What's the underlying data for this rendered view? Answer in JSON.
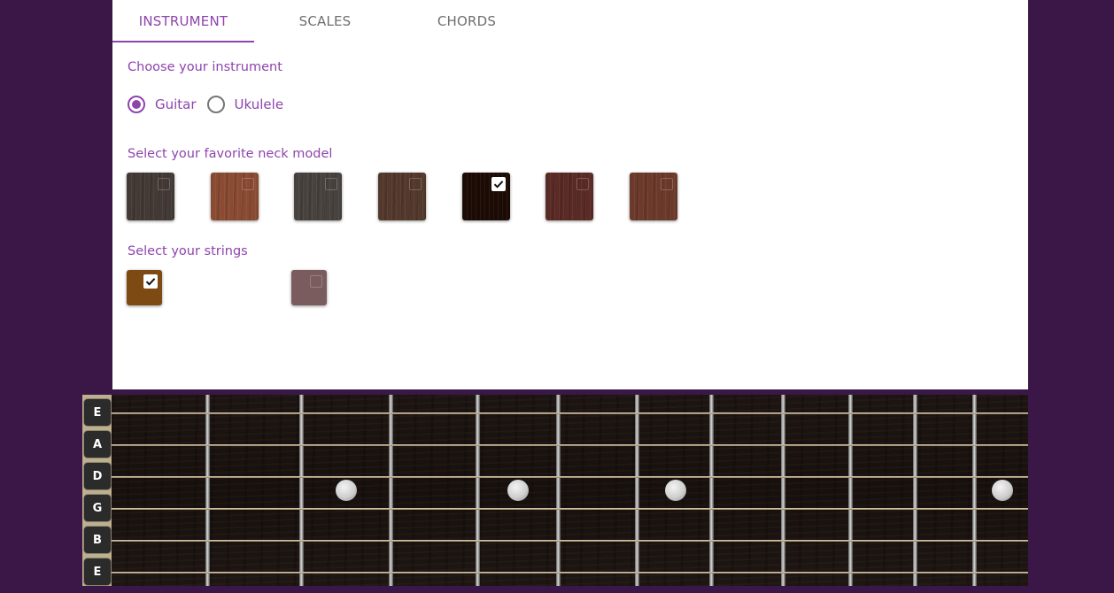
{
  "tabs": [
    {
      "label": "INSTRUMENT",
      "active": true
    },
    {
      "label": "SCALES",
      "active": false
    },
    {
      "label": "CHORDS",
      "active": false
    }
  ],
  "instrument": {
    "heading": "Choose your instrument",
    "options": [
      {
        "label": "Guitar",
        "checked": true
      },
      {
        "label": "Ukulele",
        "checked": false
      }
    ]
  },
  "neck": {
    "heading": "Select your favorite neck model",
    "models": [
      {
        "color": "#433a36",
        "selected": false
      },
      {
        "color": "#8a4b32",
        "selected": false
      },
      {
        "color": "#48423f",
        "selected": false
      },
      {
        "color": "#53392c",
        "selected": false
      },
      {
        "color": "#1c0b05",
        "selected": true
      },
      {
        "color": "#5a2a25",
        "selected": false
      },
      {
        "color": "#6c3a2a",
        "selected": false
      }
    ]
  },
  "strings": {
    "heading": "Select your strings",
    "options": [
      {
        "color": "#7c4a12",
        "selected": true
      },
      {
        "color": "#7b5c5e",
        "selected": false
      }
    ]
  },
  "fretboard": {
    "string_names": [
      "E",
      "A",
      "D",
      "G",
      "B",
      "E"
    ],
    "fret_count": 10,
    "inlay_frets": [
      3,
      5,
      7,
      9
    ]
  },
  "colors": {
    "accent": "#8e44ad",
    "background": "#3b1748"
  }
}
